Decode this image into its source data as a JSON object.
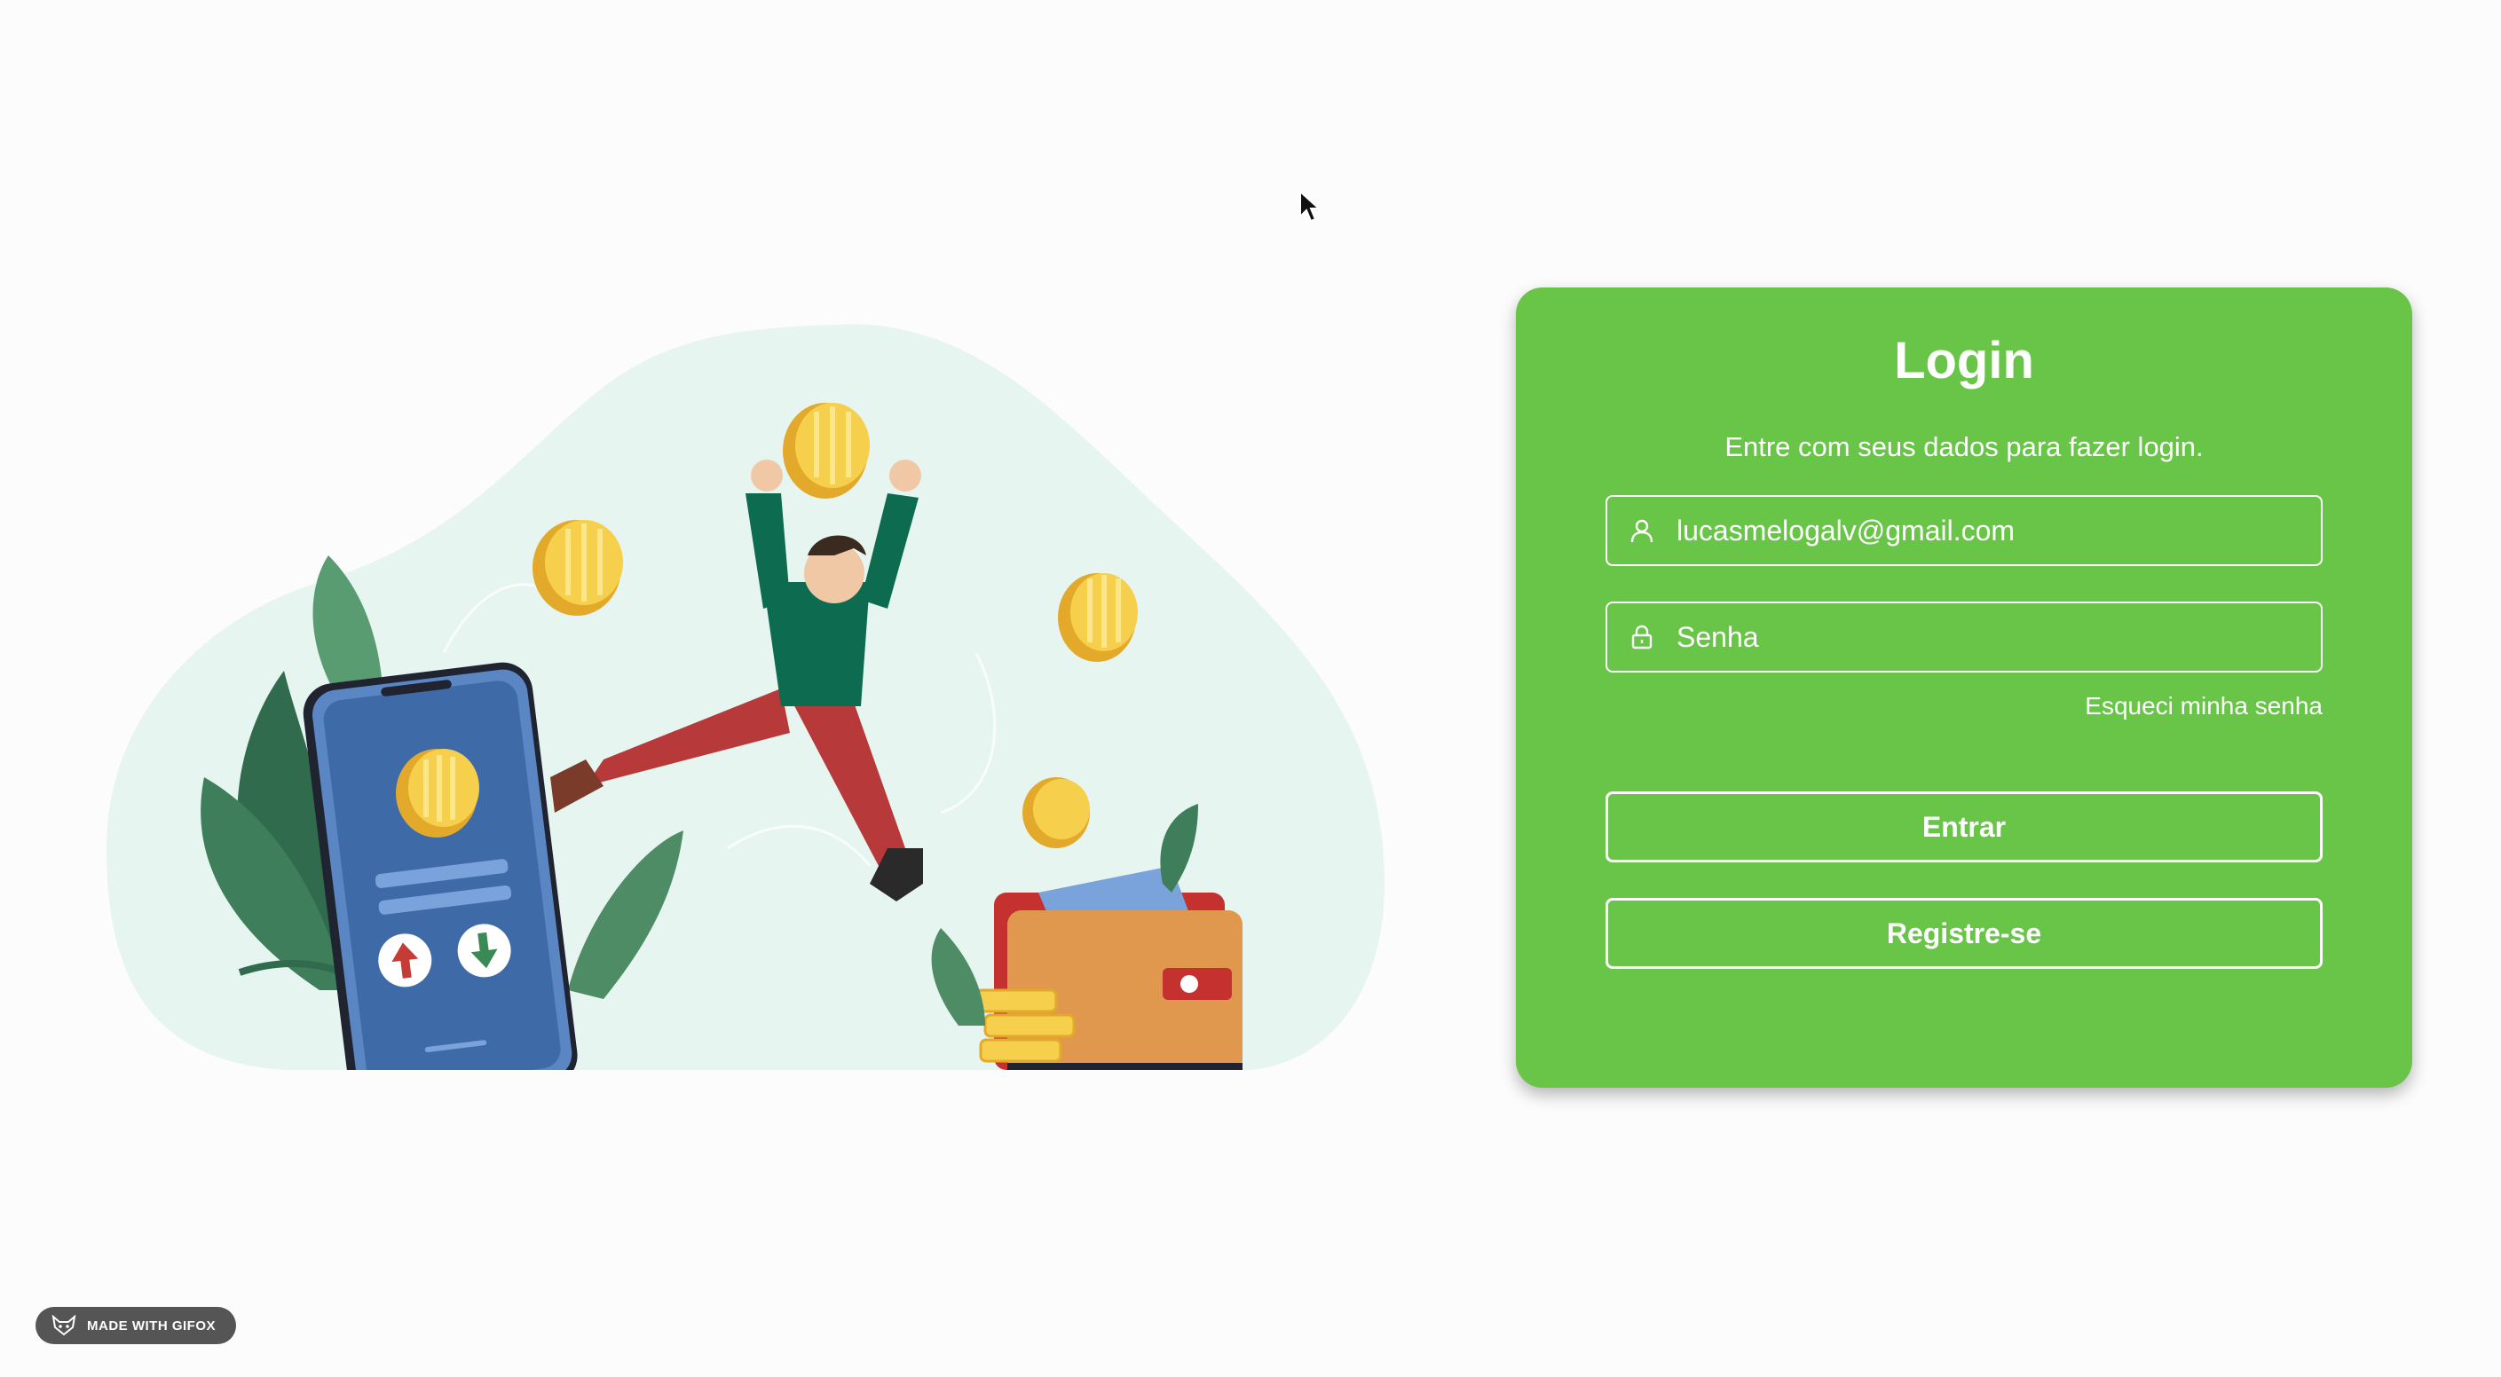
{
  "login": {
    "title": "Login",
    "subtitle": "Entre com seus dados para fazer login.",
    "email_value": "lucasmelogalv@gmail.com",
    "password_placeholder": "Senha",
    "forgot_label": "Esqueci minha senha",
    "login_button": "Entrar",
    "register_button": "Registre-se"
  },
  "icons": {
    "email": "user-icon",
    "password": "lock-icon",
    "badge": "fox-icon"
  },
  "badge": {
    "label": "MADE WITH GIFOX"
  },
  "colors": {
    "card": "#68c547",
    "text": "#ffffff",
    "background": "#fcfcfc"
  }
}
